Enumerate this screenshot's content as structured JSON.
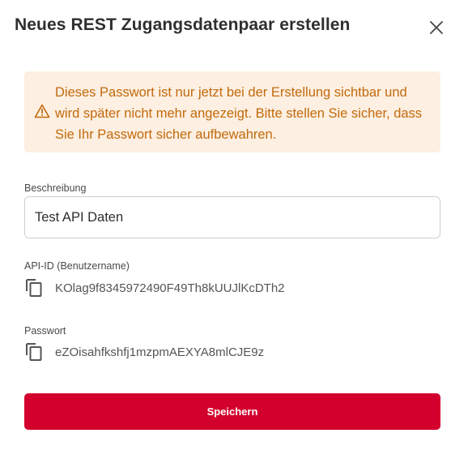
{
  "dialog": {
    "title": "Neues REST Zugangsdatenpaar erstellen",
    "close_icon": "close-icon"
  },
  "alert": {
    "icon": "warning-icon",
    "text": "Dieses Passwort ist nur jetzt bei der Erstellung sichtbar und wird später nicht mehr angezeigt. Bitte stellen Sie sicher, dass Sie Ihr Passwort sicher aufbewahren.",
    "color": "#c26a0c",
    "background": "#fdefe1"
  },
  "description": {
    "label": "Beschreibung",
    "value": "Test API Daten"
  },
  "api_id": {
    "label": "API-ID (Benutzername)",
    "value": "KOlag9f8345972490F49Th8kUUJlKcDTh2",
    "icon": "copy-icon"
  },
  "password": {
    "label": "Passwort",
    "value": "eZOisahfkshfj1mzpmAEXYA8mlCJE9z",
    "icon": "copy-icon"
  },
  "save_button": {
    "label": "Speichern",
    "color": "#d3002d"
  }
}
